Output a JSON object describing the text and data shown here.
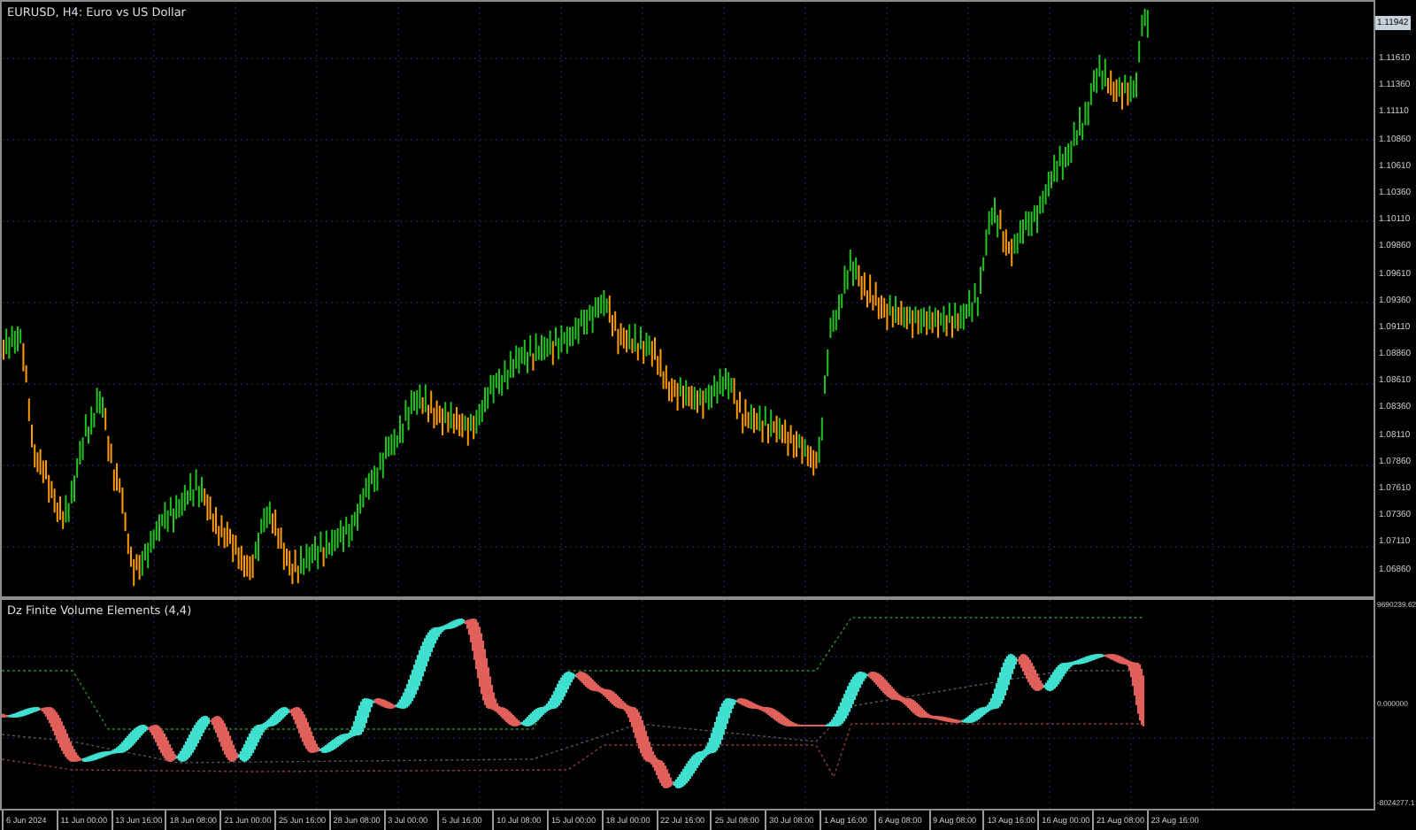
{
  "main_chart": {
    "title": "EURUSD, H4:  Euro vs US Dollar",
    "current_price": "1.11942",
    "price_axis": [
      "1.11610",
      "1.11360",
      "1.11110",
      "1.10860",
      "1.10610",
      "1.10360",
      "1.10110",
      "1.09860",
      "1.09610",
      "1.09360",
      "1.09110",
      "1.08860",
      "1.08610",
      "1.08360",
      "1.08110",
      "1.07860",
      "1.07610",
      "1.07360",
      "1.07110",
      "1.06860"
    ]
  },
  "indicator": {
    "title": "Dz Finite Volume Elements (4,4)",
    "axis": [
      "9690239.62",
      "0.000000",
      "-8024277.1"
    ]
  },
  "time_axis": [
    "6 Jun 2024",
    "11 Jun 00:00",
    "13 Jun 16:00",
    "18 Jun 08:00",
    "21 Jun 00:00",
    "25 Jun 16:00",
    "28 Jun 08:00",
    "3 Jul 00:00",
    "5 Jul 16:00",
    "10 Jul 08:00",
    "15 Jul 00:00",
    "18 Jul 00:00",
    "22 Jul 16:00",
    "25 Jul 08:00",
    "30 Jul 08:00",
    "1 Aug 16:00",
    "6 Aug 08:00",
    "9 Aug 08:00",
    "13 Aug 16:00",
    "16 Aug 00:00",
    "21 Aug 08:00",
    "23 Aug 16:00"
  ]
}
